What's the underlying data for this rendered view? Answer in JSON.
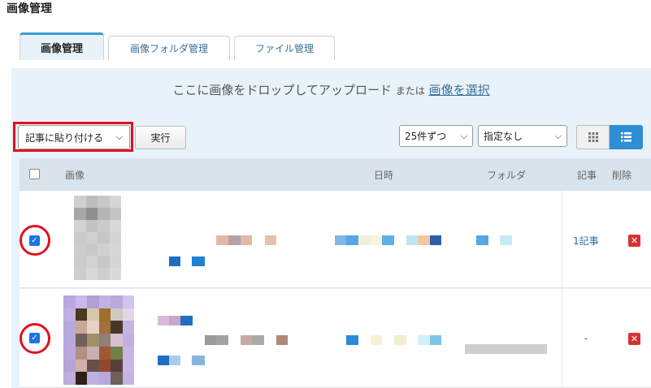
{
  "page_title": "画像管理",
  "tabs": [
    {
      "label": "画像管理",
      "active": true
    },
    {
      "label": "画像フォルダ管理",
      "active": false
    },
    {
      "label": "ファイル管理",
      "active": false
    }
  ],
  "dropzone": {
    "text": "ここに画像をドロップしてアップロード",
    "or": "または",
    "select_link": "画像を選択"
  },
  "toolbar": {
    "action_select": "記事に貼り付ける",
    "execute_label": "実行",
    "per_page": "25件ずつ",
    "folder_filter": "指定なし",
    "grid_view_icon": "grid-icon",
    "list_view_icon": "list-icon"
  },
  "table": {
    "headers": {
      "image": "画像",
      "datetime": "日時",
      "folder": "フォルダ",
      "articles": "記事",
      "delete": "削除"
    },
    "rows": [
      {
        "checked": true,
        "articles": "1記事",
        "delete_icon": "close-icon"
      },
      {
        "checked": true,
        "articles": "-",
        "delete_icon": "close-icon"
      }
    ]
  },
  "colors": {
    "accent": "#2f8dd3",
    "highlight_red": "#e01020",
    "panel_bg": "#e8f2f9",
    "delete_red": "#d63333"
  }
}
